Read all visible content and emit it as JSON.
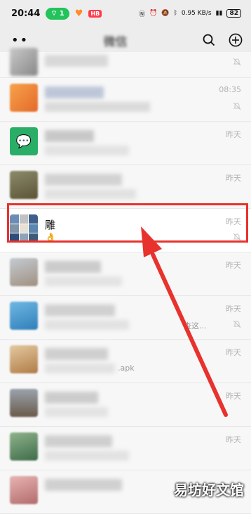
{
  "status_bar": {
    "time": "20:44",
    "pill": "1",
    "mini_badge": "HB",
    "net_rate": "0.95 KB/s",
    "battery": "82"
  },
  "title_bar": {
    "title": "微信"
  },
  "rows": [
    {
      "time": "",
      "muted": true
    },
    {
      "time": "08:35",
      "muted": true
    },
    {
      "time": "昨天",
      "muted": false
    },
    {
      "time": "昨天",
      "muted": false
    },
    {
      "name": "雕",
      "message": "👌",
      "time": "昨天",
      "muted": true
    },
    {
      "time": "昨天",
      "muted": false
    },
    {
      "message_tail": "查这...",
      "time": "昨天",
      "muted": true
    },
    {
      "message_tail": ".apk",
      "time": "昨天",
      "muted": false
    },
    {
      "time": "昨天",
      "muted": false
    },
    {
      "time": "昨天",
      "muted": false
    },
    {
      "time": "",
      "muted": false
    }
  ],
  "watermark": "易坊好文馆",
  "colors": {
    "highlight": "#e8322d",
    "status_pill": "#21c35a"
  }
}
